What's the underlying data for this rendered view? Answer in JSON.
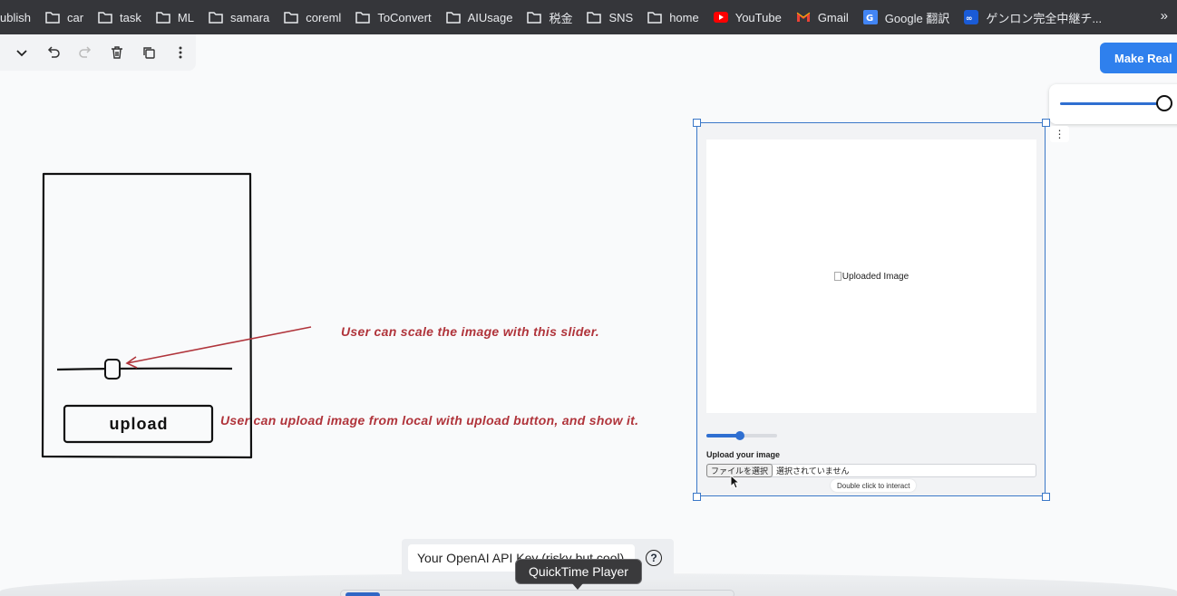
{
  "bookmarks": [
    {
      "label": "ublish",
      "icon": "none"
    },
    {
      "label": "car",
      "icon": "folder-icon"
    },
    {
      "label": "task",
      "icon": "folder-icon"
    },
    {
      "label": "ML",
      "icon": "folder-icon"
    },
    {
      "label": "samara",
      "icon": "folder-icon"
    },
    {
      "label": "coreml",
      "icon": "folder-icon"
    },
    {
      "label": "ToConvert",
      "icon": "folder-icon"
    },
    {
      "label": "AIUsage",
      "icon": "folder-icon"
    },
    {
      "label": "税金",
      "icon": "folder-icon"
    },
    {
      "label": "SNS",
      "icon": "folder-icon"
    },
    {
      "label": "home",
      "icon": "folder-icon"
    },
    {
      "label": "YouTube",
      "icon": "youtube-icon"
    },
    {
      "label": "Gmail",
      "icon": "gmail-icon"
    },
    {
      "label": "Google 翻訳",
      "icon": "google-translate-icon"
    },
    {
      "label": "ゲンロン完全中継チ...",
      "icon": "genron-icon"
    }
  ],
  "bookmarks_more": "»",
  "toolbar": {
    "icons": [
      "chevron-down-icon",
      "undo-icon",
      "redo-icon",
      "trash-icon",
      "duplicate-icon",
      "more-vertical-icon"
    ]
  },
  "make_real": {
    "label": "Make Real",
    "color": "#2f80ed"
  },
  "sketch": {
    "annotation_slider": "User can scale the image with this slider.",
    "annotation_upload": "User can upload image from local with upload button, and show it.",
    "upload_label": "upload",
    "annotation_color": "#b0343b"
  },
  "frame": {
    "image_alt": "Uploaded Image",
    "slider_value_fraction": 0.48,
    "upload_heading": "Upload your image",
    "file_button": "ファイルを選択",
    "file_status": "選択されていません",
    "hint": "Double click to interact",
    "menu_glyph": "⋮"
  },
  "api": {
    "placeholder": "Your OpenAI API Key (risky but cool)",
    "help_glyph": "?"
  },
  "tooltip": "QuickTime Player"
}
